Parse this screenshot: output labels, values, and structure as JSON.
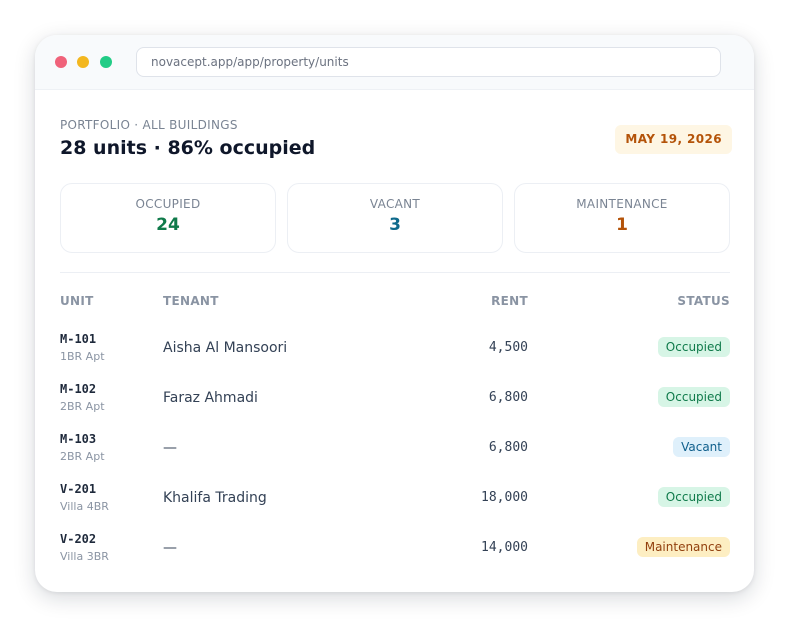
{
  "browser": {
    "url": "novacept.app/app/property/units"
  },
  "header": {
    "eyebrow": "PORTFOLIO · ALL BUILDINGS",
    "headline": "28 units · 86% occupied",
    "date": "MAY 19, 2026"
  },
  "stats": [
    {
      "label": "OCCUPIED",
      "value": "24",
      "color": "#0f7a4a"
    },
    {
      "label": "VACANT",
      "value": "3",
      "color": "#0f6a8c"
    },
    {
      "label": "MAINTENANCE",
      "value": "1",
      "color": "#b45309"
    }
  ],
  "table": {
    "columns": {
      "unit": "UNIT",
      "tenant": "TENANT",
      "rent": "RENT",
      "status": "STATUS"
    },
    "rows": [
      {
        "unit": "M-101",
        "type": "1BR Apt",
        "tenant": "Aisha Al Mansoori",
        "rent": "4,500",
        "status": "Occupied",
        "status_key": "occupied"
      },
      {
        "unit": "M-102",
        "type": "2BR Apt",
        "tenant": "Faraz Ahmadi",
        "rent": "6,800",
        "status": "Occupied",
        "status_key": "occupied"
      },
      {
        "unit": "M-103",
        "type": "2BR Apt",
        "tenant": "—",
        "rent": "6,800",
        "status": "Vacant",
        "status_key": "vacant"
      },
      {
        "unit": "V-201",
        "type": "Villa 4BR",
        "tenant": "Khalifa Trading",
        "rent": "18,000",
        "status": "Occupied",
        "status_key": "occupied"
      },
      {
        "unit": "V-202",
        "type": "Villa 3BR",
        "tenant": "—",
        "rent": "14,000",
        "status": "Maintenance",
        "status_key": "maintenance"
      }
    ]
  },
  "colors": {
    "occupied_badge_bg": "#d7f5e6",
    "vacant_badge_bg": "#dff0fb",
    "maintenance_badge_bg": "#fdeec2",
    "date_badge_bg": "#fef6e4"
  }
}
